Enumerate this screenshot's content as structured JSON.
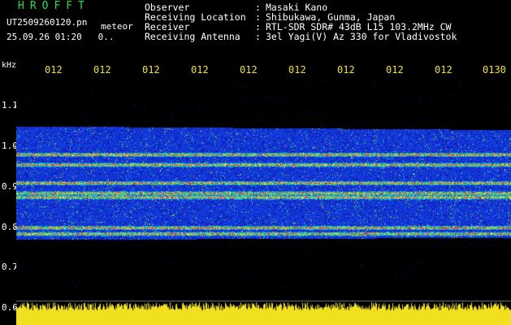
{
  "brand": "HROFFT",
  "file": {
    "name": "UT2509260120.pn",
    "suffix": "meteor",
    "datetime": "25.09.26 01:20",
    "extra": "0.."
  },
  "header": [
    {
      "key": "Observer",
      "value": "Masaki Kano"
    },
    {
      "key": "Receiving Location",
      "value": "Shibukawa, Gunma, Japan"
    },
    {
      "key": "Receiver",
      "value": "RTL-SDR SDR# 43dB L15 103.2MHz CW"
    },
    {
      "key": "Receiving Antenna",
      "value": "3el Yagi(V) Az 330 for Vladivostok"
    }
  ],
  "separator": ":",
  "unit": "kHz",
  "time_labels": [
    "012",
    "012",
    "012",
    "012",
    "012",
    "012",
    "012",
    "012",
    "012",
    "0130"
  ],
  "freq_labels": [
    "1.1",
    "1.0",
    "0.9",
    "0.8",
    "0.7",
    "0.6"
  ],
  "colors": {
    "brand": "#22e04a",
    "time_labels": "#f0e040",
    "audio_level": "#f0e020",
    "background": "#000000",
    "spectrogram_base": "#1a2a9a"
  },
  "chart_data": {
    "type": "heatmap",
    "xlabel": "",
    "ylabel": "kHz",
    "x_ticks": [
      "012",
      "012",
      "012",
      "012",
      "012",
      "012",
      "012",
      "012",
      "012",
      "0130"
    ],
    "y_ticks": [
      1.1,
      1.0,
      0.9,
      0.8,
      0.7,
      0.6
    ],
    "ylim": [
      0.6,
      1.15
    ],
    "signal_band_khz": [
      0.77,
      1.05
    ],
    "strong_lines_khz": [
      0.98,
      0.955,
      0.91,
      0.885,
      0.875,
      0.8,
      0.785
    ],
    "grid": false
  }
}
